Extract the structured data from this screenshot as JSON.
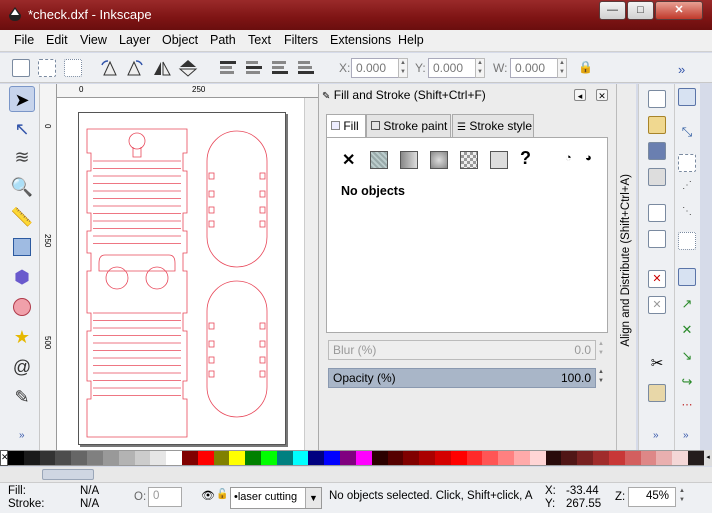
{
  "window": {
    "title": "*check.dxf - Inkscape",
    "minimize": "—",
    "maximize": "□",
    "close": "✕"
  },
  "menu": [
    "File",
    "Edit",
    "View",
    "Layer",
    "Object",
    "Path",
    "Text",
    "Filters",
    "Extensions",
    "Help"
  ],
  "toolbar": {
    "x_label": "X:",
    "x_value": "0.000",
    "y_label": "Y:",
    "y_value": "0.000",
    "w_label": "W:",
    "w_value": "0.000",
    "overflow": "»"
  },
  "ruler": {
    "h_ticks": [
      "0",
      "250"
    ],
    "v_ticks": [
      "0",
      "250",
      "500"
    ]
  },
  "dialog": {
    "title": "Fill and Stroke (Shift+Ctrl+F)",
    "tabs": [
      "Fill",
      "Stroke paint",
      "Stroke style"
    ],
    "active_tab": "Fill",
    "status": "No objects",
    "blur_label": "Blur (%)",
    "blur_value": "0.0",
    "opacity_label": "Opacity (%)",
    "opacity_value": "100.0",
    "opacity_level": 1.0
  },
  "align_tab": "Align and Distribute (Shift+Ctrl+A)",
  "palette": [
    "#000000",
    "#1a1a1a",
    "#333333",
    "#4d4d4d",
    "#666666",
    "#808080",
    "#999999",
    "#b3b3b3",
    "#cccccc",
    "#e6e6e6",
    "#ffffff",
    "#800000",
    "#ff0000",
    "#808000",
    "#ffff00",
    "#008000",
    "#00ff00",
    "#008080",
    "#00ffff",
    "#000080",
    "#0000ff",
    "#800080",
    "#ff00ff",
    "#2b0000",
    "#550000",
    "#800000",
    "#aa0000",
    "#d40000",
    "#ff0000",
    "#ff2a2a",
    "#ff5555",
    "#ff8080",
    "#ffaaaa",
    "#ffd5d5",
    "#280b0b",
    "#501616",
    "#782121",
    "#a02c2c",
    "#c83737",
    "#d35f5f",
    "#de8787",
    "#e9afaf",
    "#f4d7d7",
    "#241c1c"
  ],
  "status": {
    "fill_label": "Fill:",
    "fill_value": "N/A",
    "stroke_label": "Stroke:",
    "stroke_value": "N/A",
    "o_label": "O:",
    "o_value": "0",
    "layer": "•laser cutting",
    "message": "No objects selected. Click, Shift+click, A",
    "x_label": "X:",
    "x_value": "-33.44",
    "y_label": "Y:",
    "y_value": "267.55",
    "z_label": "Z:",
    "zoom": "45%"
  }
}
